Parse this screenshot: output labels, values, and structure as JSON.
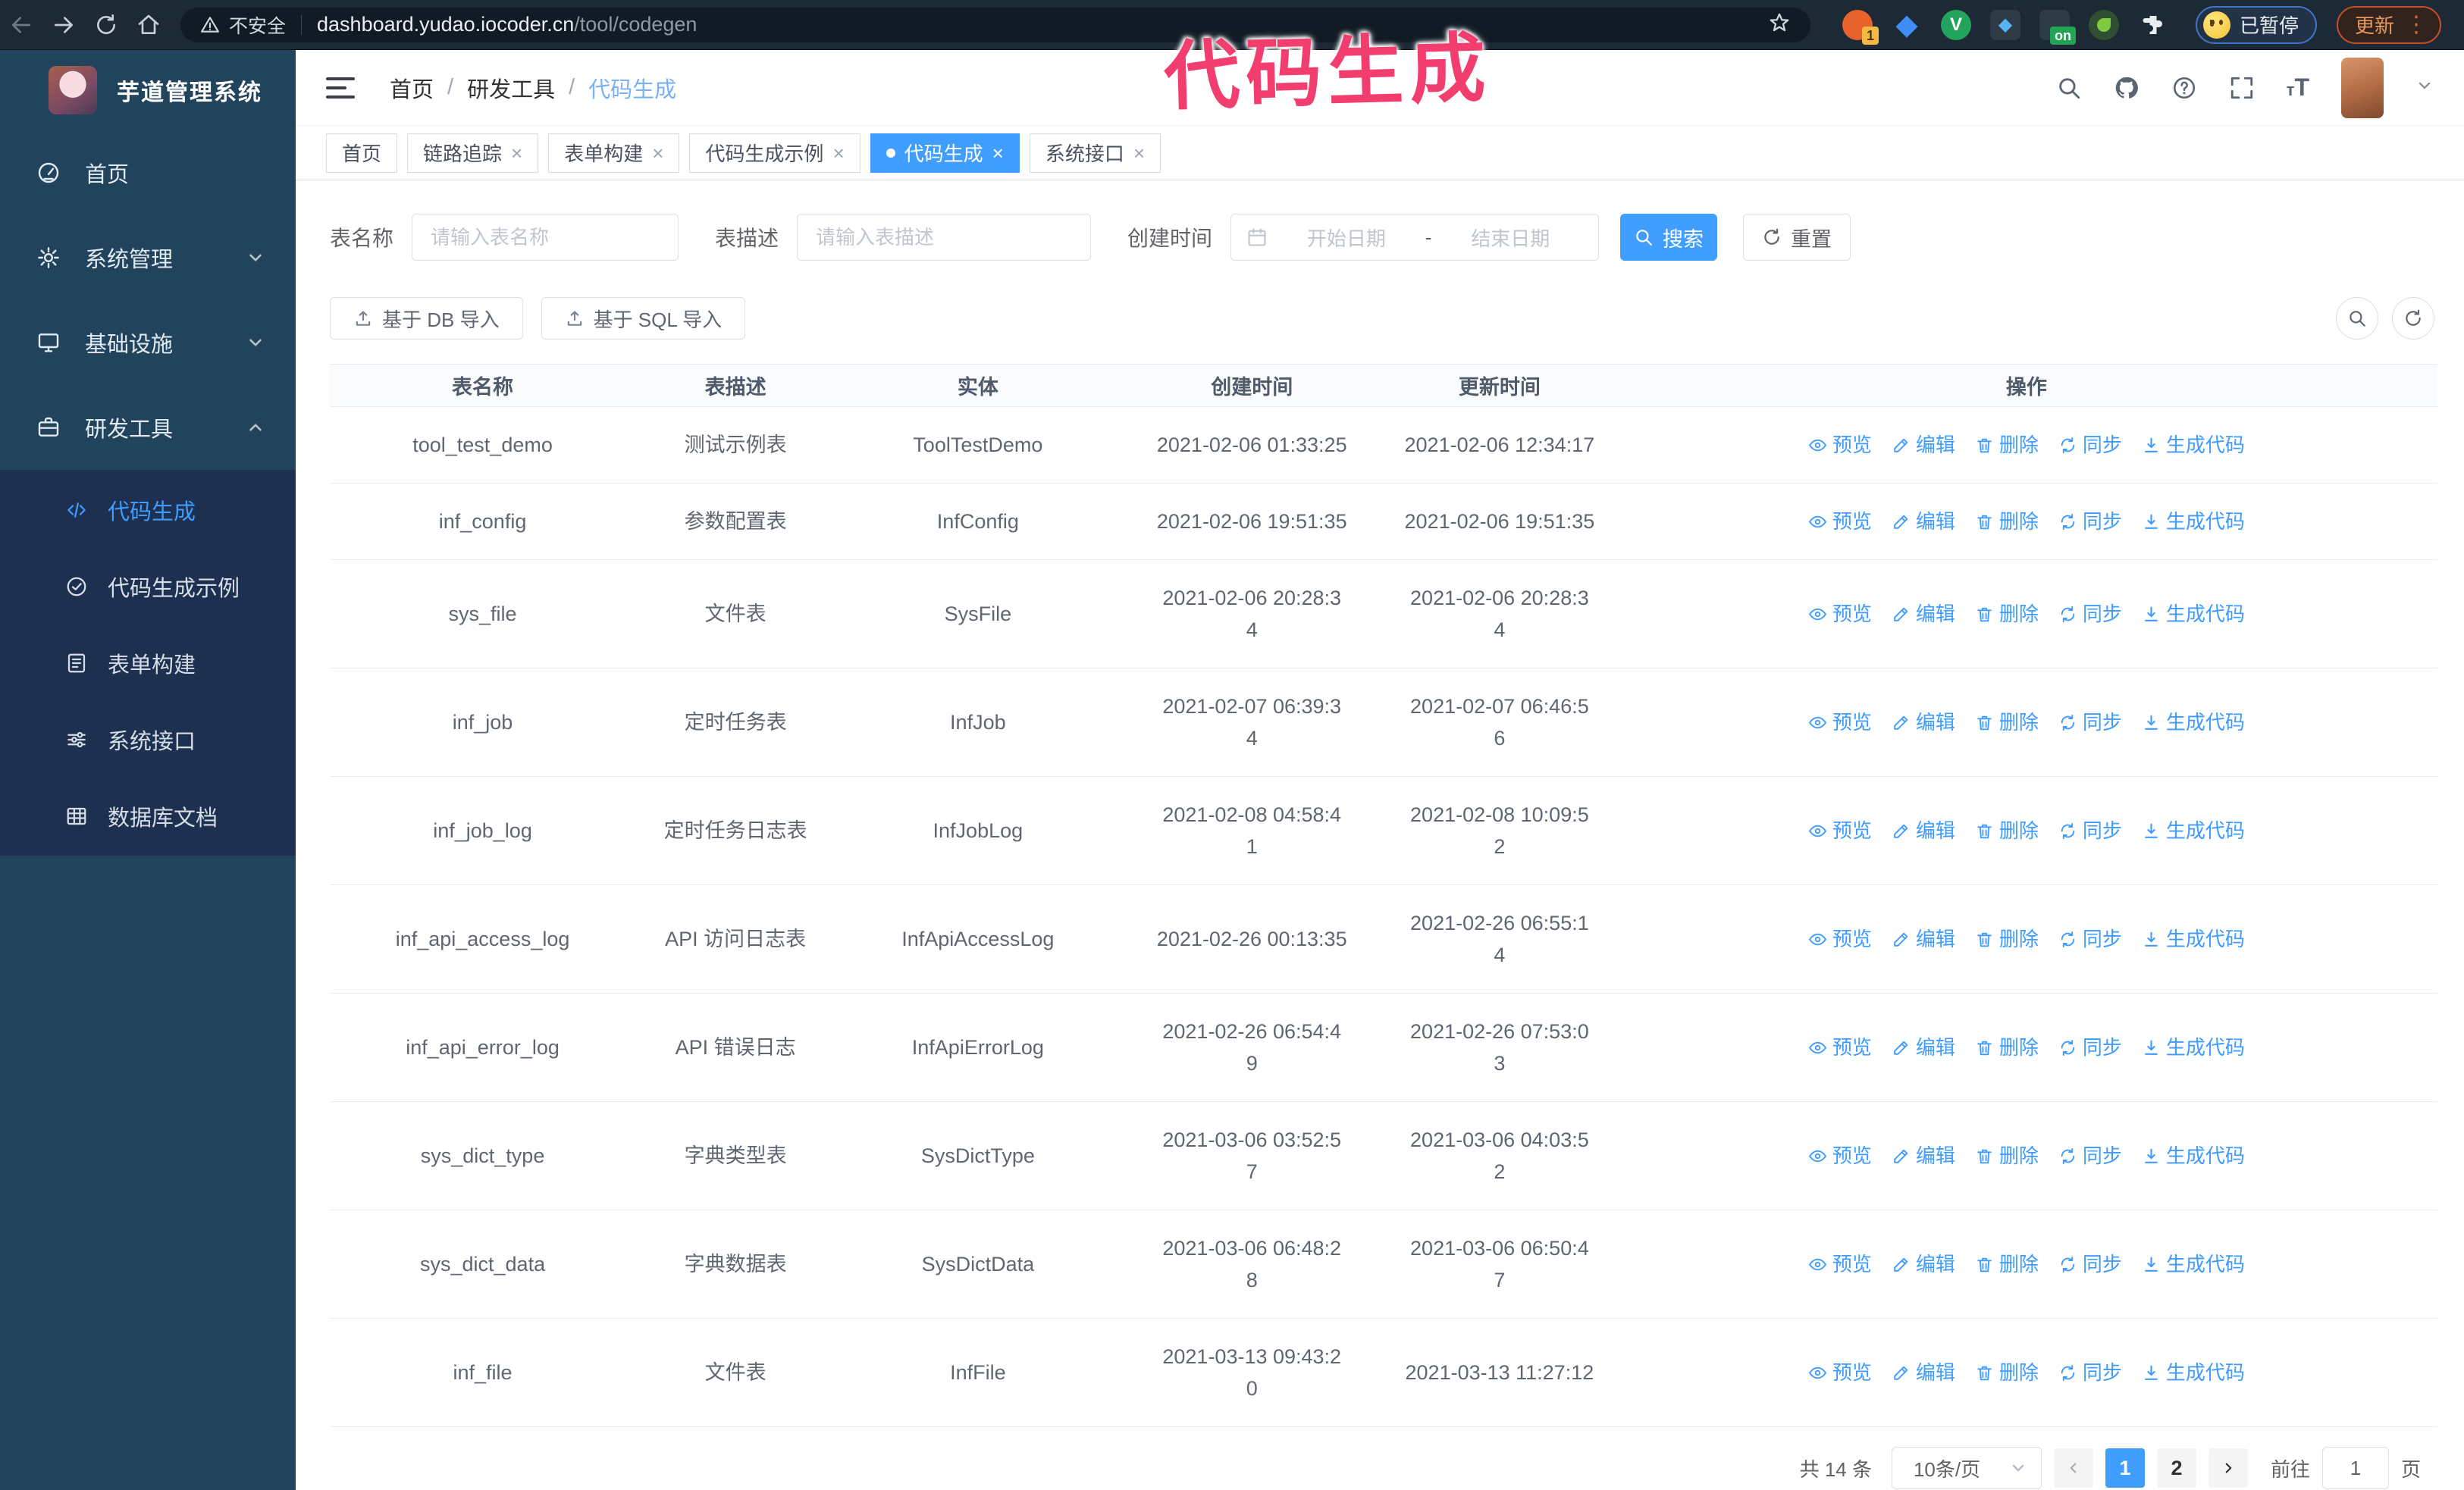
{
  "colors": {
    "accent": "#409eff",
    "sidebar_bg": "#21435c",
    "submenu_bg": "#1d3050",
    "browser_bg": "#1d2935",
    "annotation": "#f23e6e"
  },
  "annotation": {
    "text": "代码生成"
  },
  "browser": {
    "security_label": "不安全",
    "url_host": "dashboard.yudao.iocoder.cn",
    "url_path": "/tool/codegen",
    "ext_badge_1": "1",
    "ext_badge_on": "on",
    "ext_check": "V",
    "profile_badge": "已暂停",
    "update_label": "更新",
    "kebab": "⋮"
  },
  "sidebar": {
    "title": "芋道管理系统",
    "items": [
      {
        "label": "首页"
      },
      {
        "label": "系统管理"
      },
      {
        "label": "基础设施"
      },
      {
        "label": "研发工具"
      }
    ],
    "submenu": [
      {
        "label": "代码生成"
      },
      {
        "label": "代码生成示例"
      },
      {
        "label": "表单构建"
      },
      {
        "label": "系统接口"
      },
      {
        "label": "数据库文档"
      }
    ]
  },
  "header": {
    "breadcrumb": [
      "首页",
      "研发工具",
      "代码生成"
    ],
    "breadcrumb_separator": "/"
  },
  "tabs": [
    {
      "label": "首页"
    },
    {
      "label": "链路追踪"
    },
    {
      "label": "表单构建"
    },
    {
      "label": "代码生成示例"
    },
    {
      "label": "代码生成"
    },
    {
      "label": "系统接口"
    }
  ],
  "search": {
    "name_label": "表名称",
    "name_placeholder": "请输入表名称",
    "desc_label": "表描述",
    "desc_placeholder": "请输入表描述",
    "time_label": "创建时间",
    "start_placeholder": "开始日期",
    "range_separator": "-",
    "end_placeholder": "结束日期",
    "search_button": "搜索",
    "reset_button": "重置"
  },
  "toolbar": {
    "db_import": "基于 DB 导入",
    "sql_import": "基于 SQL 导入"
  },
  "table": {
    "columns": [
      "表名称",
      "表描述",
      "实体",
      "创建时间",
      "更新时间",
      "操作"
    ],
    "actions": [
      "预览",
      "编辑",
      "删除",
      "同步",
      "生成代码"
    ],
    "rows": [
      {
        "name": "tool_test_demo",
        "desc": "测试示例表",
        "entity": "ToolTestDemo",
        "created": "2021-02-06 01:33:25",
        "updated": "2021-02-06 12:34:17"
      },
      {
        "name": "inf_config",
        "desc": "参数配置表",
        "entity": "InfConfig",
        "created": "2021-02-06 19:51:35",
        "updated": "2021-02-06 19:51:35"
      },
      {
        "name": "sys_file",
        "desc": "文件表",
        "entity": "SysFile",
        "created": "2021-02-06 20:28:3\n4",
        "updated": "2021-02-06 20:28:3\n4"
      },
      {
        "name": "inf_job",
        "desc": "定时任务表",
        "entity": "InfJob",
        "created": "2021-02-07 06:39:3\n4",
        "updated": "2021-02-07 06:46:5\n6"
      },
      {
        "name": "inf_job_log",
        "desc": "定时任务日志表",
        "entity": "InfJobLog",
        "created": "2021-02-08 04:58:4\n1",
        "updated": "2021-02-08 10:09:5\n2"
      },
      {
        "name": "inf_api_access_log",
        "desc": "API 访问日志表",
        "entity": "InfApiAccessLog",
        "created": "2021-02-26 00:13:35",
        "updated": "2021-02-26 06:55:1\n4"
      },
      {
        "name": "inf_api_error_log",
        "desc": "API 错误日志",
        "entity": "InfApiErrorLog",
        "created": "2021-02-26 06:54:4\n9",
        "updated": "2021-02-26 07:53:0\n3"
      },
      {
        "name": "sys_dict_type",
        "desc": "字典类型表",
        "entity": "SysDictType",
        "created": "2021-03-06 03:52:5\n7",
        "updated": "2021-03-06 04:03:5\n2"
      },
      {
        "name": "sys_dict_data",
        "desc": "字典数据表",
        "entity": "SysDictData",
        "created": "2021-03-06 06:48:2\n8",
        "updated": "2021-03-06 06:50:4\n7"
      },
      {
        "name": "inf_file",
        "desc": "文件表",
        "entity": "InfFile",
        "created": "2021-03-13 09:43:2\n0",
        "updated": "2021-03-13 11:27:12"
      }
    ]
  },
  "pagination": {
    "total": "共 14 条",
    "page_size": "10条/页",
    "pages": [
      "1",
      "2"
    ],
    "goto_label": "前往",
    "goto_value": "1",
    "goto_suffix": "页"
  }
}
